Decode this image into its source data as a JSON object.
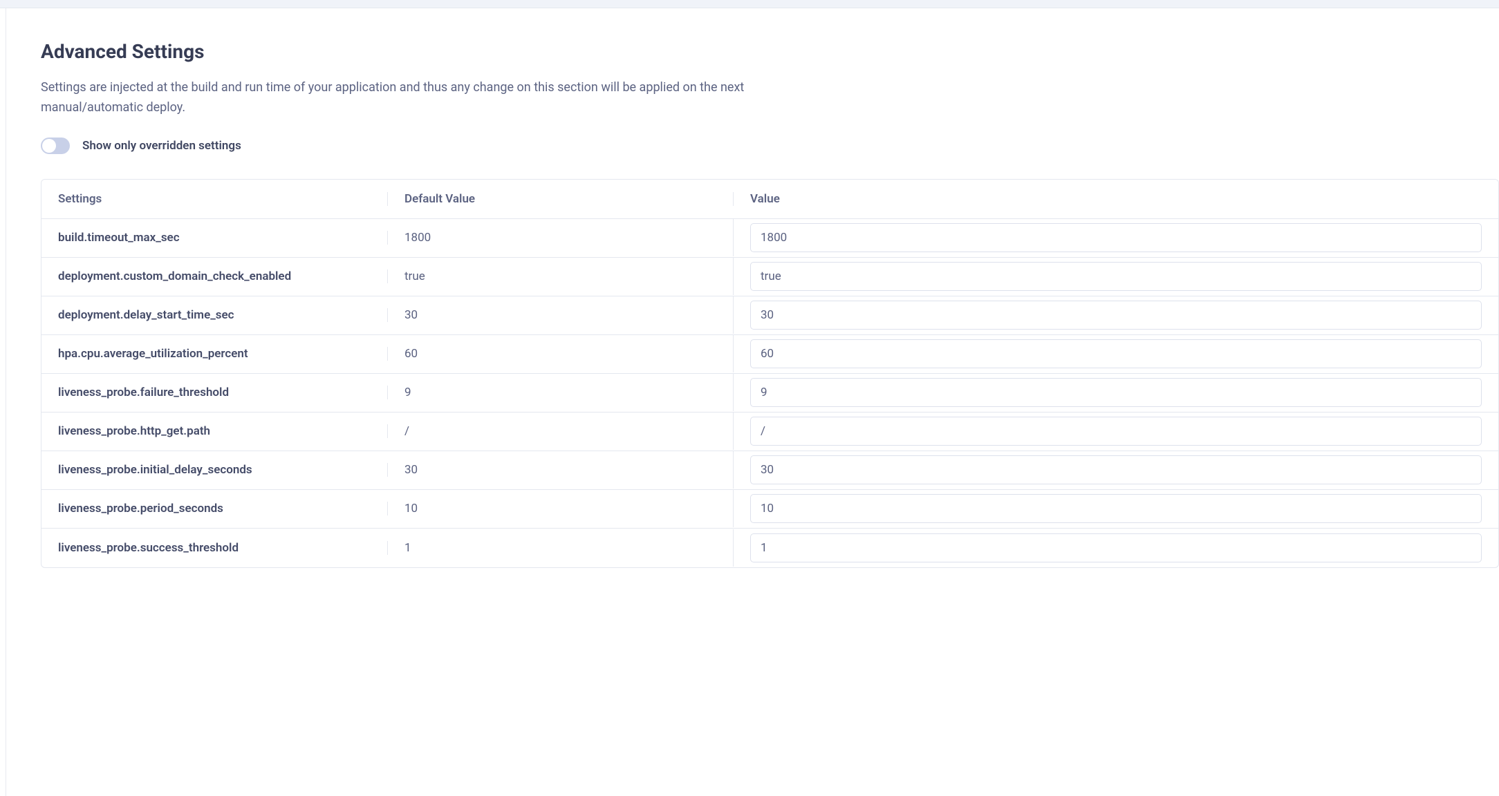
{
  "header": {
    "title": "Advanced Settings",
    "description": "Settings are injected at the build and run time of your application and thus any change on this section will be applied on the next manual/automatic deploy."
  },
  "toggle": {
    "label": "Show only overridden settings",
    "checked": false
  },
  "table": {
    "columns": {
      "setting": "Settings",
      "default": "Default Value",
      "value": "Value"
    },
    "rows": [
      {
        "setting": "build.timeout_max_sec",
        "default": "1800",
        "value": "1800"
      },
      {
        "setting": "deployment.custom_domain_check_enabled",
        "default": "true",
        "value": "true"
      },
      {
        "setting": "deployment.delay_start_time_sec",
        "default": "30",
        "value": "30"
      },
      {
        "setting": "hpa.cpu.average_utilization_percent",
        "default": "60",
        "value": "60"
      },
      {
        "setting": "liveness_probe.failure_threshold",
        "default": "9",
        "value": "9"
      },
      {
        "setting": "liveness_probe.http_get.path",
        "default": "/",
        "value": "/"
      },
      {
        "setting": "liveness_probe.initial_delay_seconds",
        "default": "30",
        "value": "30"
      },
      {
        "setting": "liveness_probe.period_seconds",
        "default": "10",
        "value": "10"
      },
      {
        "setting": "liveness_probe.success_threshold",
        "default": "1",
        "value": "1"
      }
    ]
  }
}
